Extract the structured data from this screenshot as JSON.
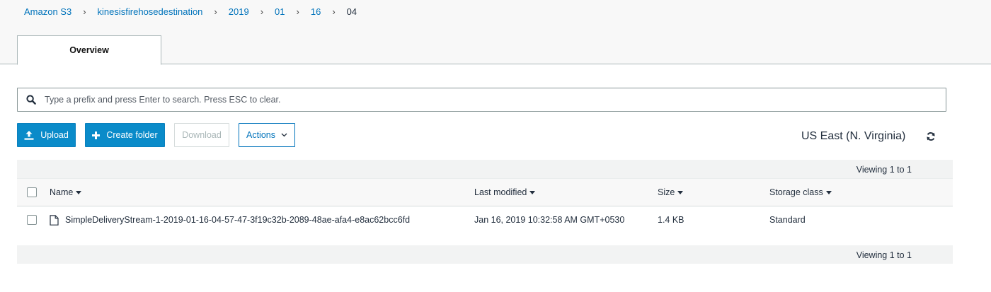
{
  "breadcrumb": [
    {
      "label": "Amazon S3"
    },
    {
      "label": "kinesisfirehosedestination"
    },
    {
      "label": "2019"
    },
    {
      "label": "01"
    },
    {
      "label": "16"
    },
    {
      "label": "04"
    }
  ],
  "tabs": [
    {
      "label": "Overview",
      "active": true
    }
  ],
  "search": {
    "placeholder": "Type a prefix and press Enter to search. Press ESC to clear.",
    "value": ""
  },
  "toolbar": {
    "upload_label": "Upload",
    "create_folder_label": "Create folder",
    "download_label": "Download",
    "actions_label": "Actions"
  },
  "region": {
    "label": "US East (N. Virginia)"
  },
  "table": {
    "viewing_top": "Viewing 1 to 1",
    "viewing_bottom": "Viewing 1 to 1",
    "columns": {
      "name": "Name",
      "last_modified": "Last modified",
      "size": "Size",
      "storage_class": "Storage class"
    },
    "rows": [
      {
        "name": "SimpleDeliveryStream-1-2019-01-16-04-57-47-3f19c32b-2089-48ae-afa4-e8ac62bcc6fd",
        "last_modified": "Jan 16, 2019 10:32:58 AM GMT+0530",
        "size": "1.4 KB",
        "storage_class": "Standard"
      }
    ]
  },
  "colors": {
    "primary_button": "#0a8bc9",
    "link": "#0073bb",
    "border": "#aab7b8"
  },
  "icons": [
    "search-icon",
    "upload-icon",
    "plus-icon",
    "chevron-down-icon",
    "refresh-icon",
    "file-icon"
  ]
}
